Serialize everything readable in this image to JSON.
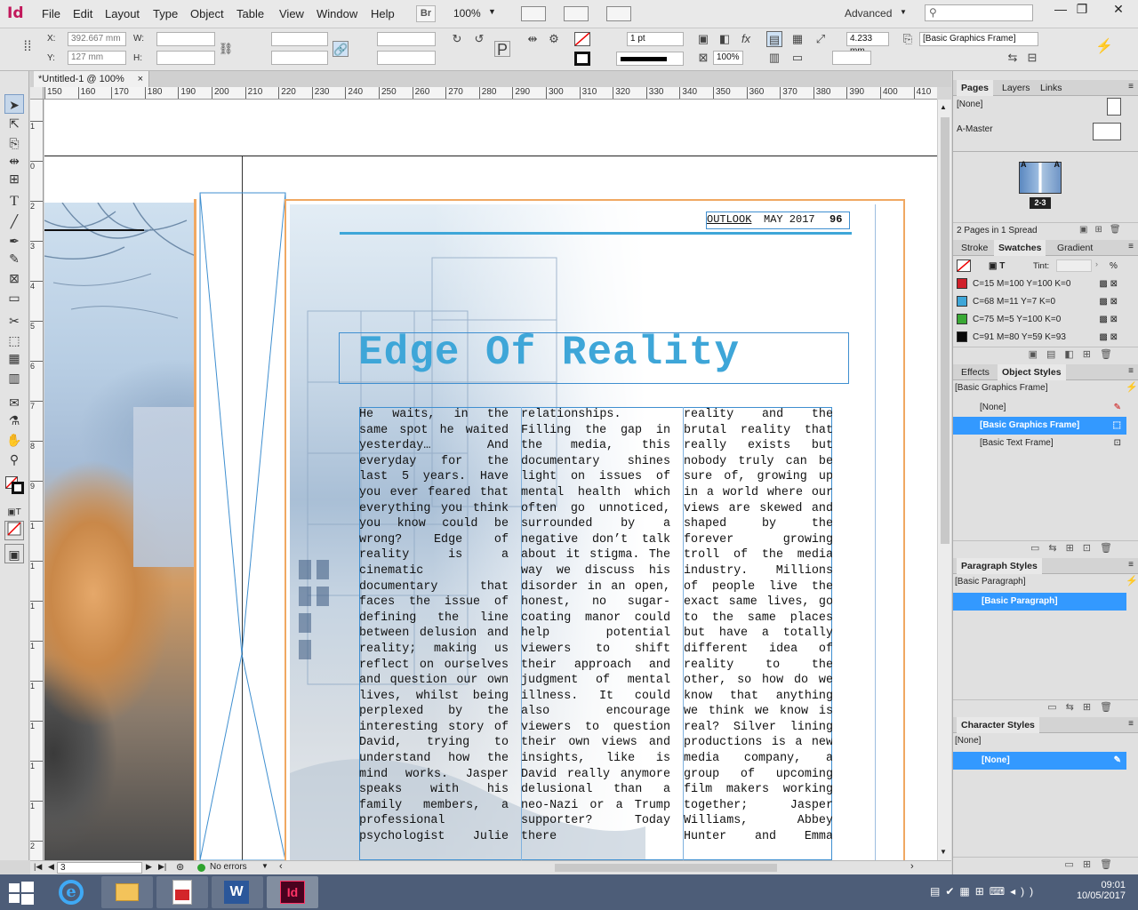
{
  "app": {
    "logo": "Id"
  },
  "menu": [
    "File",
    "Edit",
    "Layout",
    "Type",
    "Object",
    "Table",
    "View",
    "Window",
    "Help"
  ],
  "menubar": {
    "bridge": "Br",
    "zoom": "100%",
    "workspace": "Advanced",
    "search_placeholder": ""
  },
  "window_controls": {
    "minimize": "—",
    "restore": "❐",
    "close": "✕"
  },
  "control": {
    "x_label": "X:",
    "x_value": "392.667 mm",
    "y_label": "Y:",
    "y_value": "127 mm",
    "w_label": "W:",
    "h_label": "H:",
    "stroke_weight": "1 pt",
    "scale": "100%",
    "offset": "4.233 mm",
    "object_style": "[Basic Graphics Frame]"
  },
  "document_tab": {
    "title": "*Untitled-1 @ 100%",
    "close": "×"
  },
  "ruler": {
    "h_ticks": [
      "150",
      "160",
      "170",
      "180",
      "190",
      "200",
      "210",
      "220",
      "230",
      "240",
      "250",
      "260",
      "270",
      "280",
      "290",
      "300",
      "310",
      "320",
      "330",
      "340",
      "350",
      "360",
      "370",
      "380",
      "390",
      "400",
      "410"
    ],
    "v_ticks": [
      "1",
      "0",
      "2",
      "3",
      "4",
      "5",
      "6",
      "7",
      "8",
      "9",
      "1",
      "1",
      "1",
      "1",
      "1",
      "1",
      "1",
      "1",
      "2"
    ]
  },
  "page": {
    "header": {
      "magazine": "OUTLOOK",
      "date": "MAY 2017",
      "page_number": "96"
    },
    "title": "Edge Of Reality",
    "columns": [
      "He waits, in the same spot he waited yesterday… And everyday for the last 5 years. Have you ever feared that everything you think you know could be wrong? Edge of reality is a cinematic documentary that faces the issue of defining the line between delusion and reality; making us reflect on ourselves and question our own lives, whilst being perplexed by the interesting story of David, trying to understand how the mind works. Jasper speaks with his family members, a professional psychologist Julie",
      "relationships. Filling the gap in the media, this documentary shines light on issues of mental health which often go unnoticed, surrounded by a negative don’t talk about it stigma. The way we discuss his disorder in an open, honest, no sugar-coating manor could help potential viewers to shift their approach and judgment of mental illness. It could also encourage viewers to question their own views and insights, like is David really anymore delusional than a neo-Nazi or a Trump supporter? Today there",
      "reality and the brutal reality that really exists but nobody truly can be sure of, growing up in a world where our views are skewed and shaped by the forever growing troll of the media industry. Millions of people live the exact same lives, go to the same places but have a totally different idea of reality to the other, so how do we know that anything we think we know is real? Silver lining productions is a new media company, a group of upcoming film makers working together; Jasper Williams, Abbey Hunter and Emma"
    ]
  },
  "status": {
    "page": "3",
    "errors": "No errors"
  },
  "panels": {
    "pages": {
      "tabs": [
        "Pages",
        "Layers",
        "Links"
      ],
      "items": [
        "[None]",
        "A-Master"
      ],
      "spread_label": "2-3",
      "footer": "2 Pages in 1 Spread"
    },
    "swatches": {
      "tabs": [
        "Stroke",
        "Swatches",
        "Gradient"
      ],
      "tint_label": "Tint:",
      "tint_unit": "%",
      "items": [
        {
          "name": "C=15 M=100 Y=100 K=0",
          "color": "#d0202a"
        },
        {
          "name": "C=68 M=11 Y=7 K=0",
          "color": "#3ea6d8"
        },
        {
          "name": "C=75 M=5 Y=100 K=0",
          "color": "#3aa935"
        },
        {
          "name": "C=91 M=80 Y=59 K=93",
          "color": "#0a0a0a"
        }
      ]
    },
    "object_styles": {
      "tabs": [
        "Effects",
        "Object Styles"
      ],
      "current": "[Basic Graphics Frame]",
      "items": [
        "[None]",
        "[Basic Graphics Frame]",
        "[Basic Text Frame]"
      ],
      "selected_index": 1
    },
    "paragraph_styles": {
      "title": "Paragraph Styles",
      "current": "[Basic Paragraph]",
      "items": [
        "[Basic Paragraph]"
      ]
    },
    "character_styles": {
      "title": "Character Styles",
      "current": "[None]",
      "items": [
        "[None]"
      ]
    }
  },
  "taskbar": {
    "time": "09:01",
    "date": "10/05/2017"
  },
  "colors": {
    "accent": "#3ea6d8",
    "selection": "#3399ff",
    "indesign": "#c2185b"
  }
}
